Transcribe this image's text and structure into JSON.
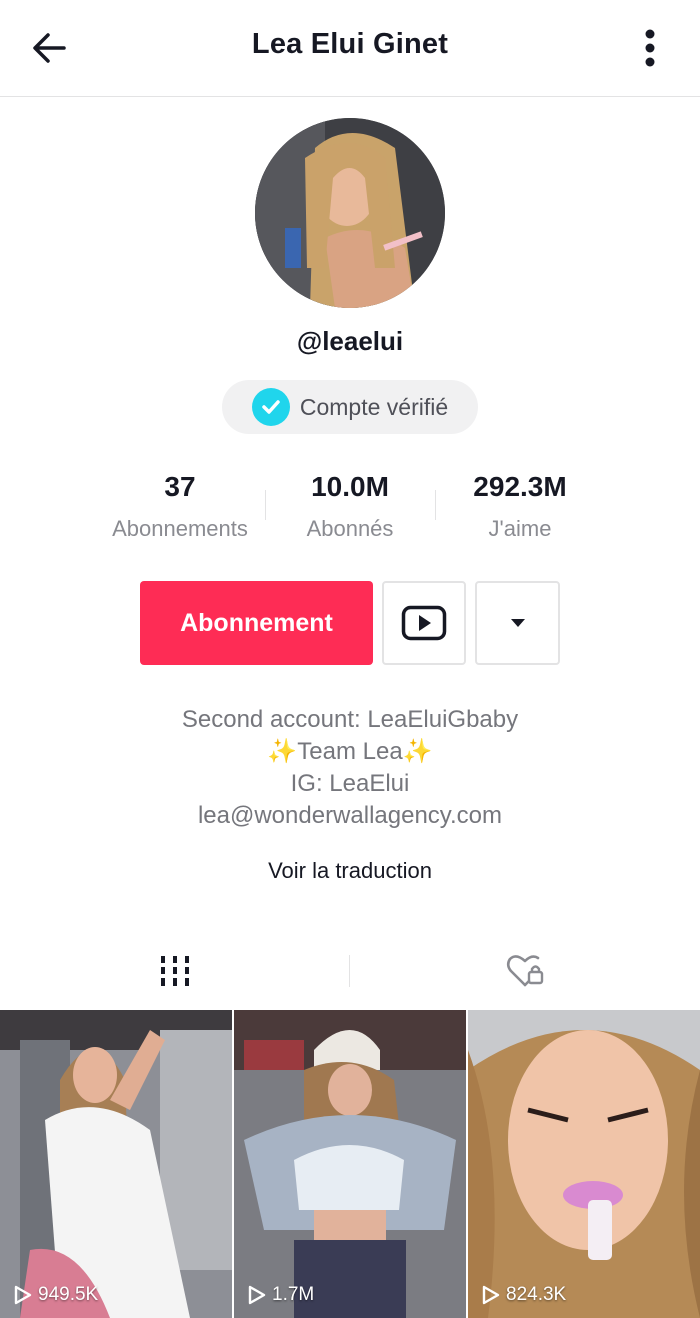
{
  "header": {
    "title": "Lea Elui Ginet"
  },
  "profile": {
    "username": "@leaelui",
    "verified_label": "Compte vérifié"
  },
  "stats": [
    {
      "value": "37",
      "label": "Abonnements"
    },
    {
      "value": "10.0M",
      "label": "Abonnés"
    },
    {
      "value": "292.3M",
      "label": "J'aime"
    }
  ],
  "actions": {
    "follow_label": "Abonnement"
  },
  "bio": {
    "lines": [
      "Second account: LeaEluiGbaby",
      "✨Team Lea✨",
      "IG: LeaElui",
      "lea@wonderwallagency.com"
    ],
    "translate_label": "Voir la traduction"
  },
  "videos": [
    {
      "views": "949.5K"
    },
    {
      "views": "1.7M"
    },
    {
      "views": "824.3K"
    }
  ],
  "colors": {
    "accent": "#fe2c55",
    "verified": "#20d5ec",
    "text_primary": "#161823",
    "text_secondary": "#8a8b91"
  },
  "icons": {
    "back": "arrow-left-icon",
    "more": "more-vertical-icon",
    "verified": "check-badge-icon",
    "youtube": "youtube-icon",
    "dropdown": "caret-down-icon",
    "videos_tab": "grid-icon",
    "liked_tab": "heart-lock-icon",
    "play": "play-icon"
  }
}
